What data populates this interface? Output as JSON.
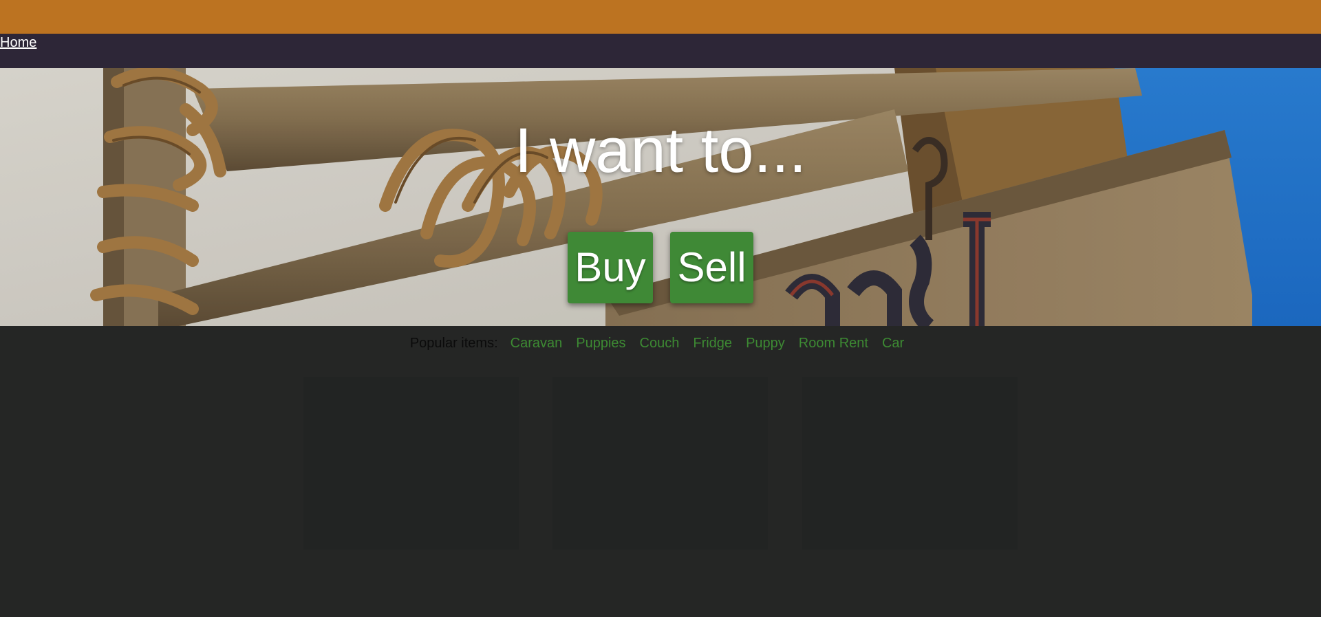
{
  "nav": {
    "home_label": "Home"
  },
  "hero": {
    "title": "I want to...",
    "buy_label": "Buy",
    "sell_label": "Sell"
  },
  "popular": {
    "label": "Popular items:",
    "items": [
      "Caravan",
      "Puppies",
      "Couch",
      "Fridge",
      "Puppy",
      "Room Rent",
      "Car"
    ]
  },
  "colors": {
    "topbar": "#bc7321",
    "navbar": "#2d2637",
    "button": "#3f8936",
    "link": "#3d8a33",
    "background": "#252625",
    "card": "#222423"
  }
}
